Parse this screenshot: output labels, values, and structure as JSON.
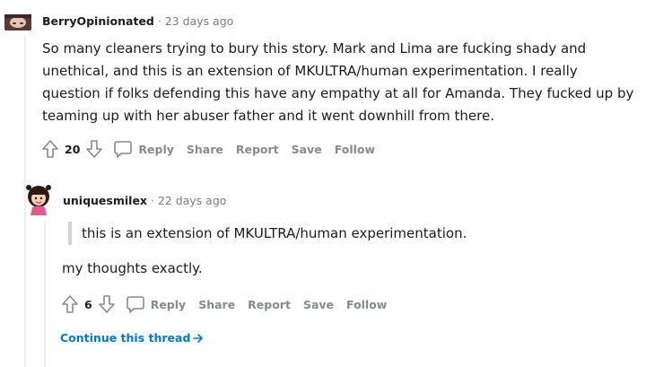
{
  "comments": [
    {
      "username": "BerryOpinionated",
      "separator": "·",
      "age": "23 days ago",
      "body": "So many cleaners trying to bury this story. Mark and Lima are fucking shady and unethical, and this is an extension of MKULTRA/human experimentation. I really question if folks defending this have any empathy at all for Amanda. They fucked up by teaming up with her abuser father and it went downhill from there.",
      "score": "20",
      "actions": {
        "reply": "Reply",
        "share": "Share",
        "report": "Report",
        "save": "Save",
        "follow": "Follow"
      }
    },
    {
      "username": "uniquesmilex",
      "separator": "·",
      "age": "22 days ago",
      "quote": "this is an extension of MKULTRA/human experimentation.",
      "body": "my thoughts exactly.",
      "score": "6",
      "actions": {
        "reply": "Reply",
        "share": "Share",
        "report": "Report",
        "save": "Save",
        "follow": "Follow"
      }
    }
  ],
  "continue_thread": "Continue this thread",
  "icons": {
    "upvote": "upvote-arrow-icon",
    "downvote": "downvote-arrow-icon",
    "reply": "speech-bubble-icon",
    "continue": "arrow-right-icon"
  },
  "colors": {
    "link": "#0079d3",
    "meta": "#7c7c7c",
    "action": "#878a8c"
  }
}
